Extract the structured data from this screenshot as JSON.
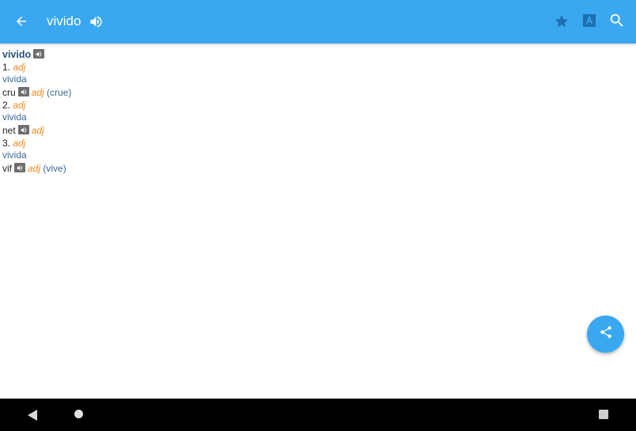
{
  "appbar": {
    "title": "vivido",
    "icons": [
      "back-arrow-icon",
      "speaker-icon",
      "star-icon",
      "translate-icon",
      "search-icon"
    ],
    "color": "#3aa8f0"
  },
  "entry": {
    "headword": "vivido",
    "senses": [
      {
        "number": "1.",
        "pos": "adj",
        "gloss": "vivida",
        "translation": {
          "word": "cru",
          "pos": "adj",
          "feminine": "crue"
        }
      },
      {
        "number": "2.",
        "pos": "adj",
        "gloss": "vivida",
        "translation": {
          "word": "net",
          "pos": "adj",
          "feminine": ""
        }
      },
      {
        "number": "3.",
        "pos": "adj",
        "gloss": "vivida",
        "translation": {
          "word": "vif",
          "pos": "adj",
          "feminine": "vive"
        }
      }
    ]
  },
  "fab": {
    "icon": "share-icon"
  },
  "navbar": {
    "icons": [
      "nav-back-icon",
      "nav-home-icon",
      "nav-recents-icon"
    ]
  },
  "colors": {
    "accent": "#3aa8f0",
    "pos": "#f28a1c",
    "gloss": "#3a6a9b",
    "headword": "#2b4f7a"
  }
}
